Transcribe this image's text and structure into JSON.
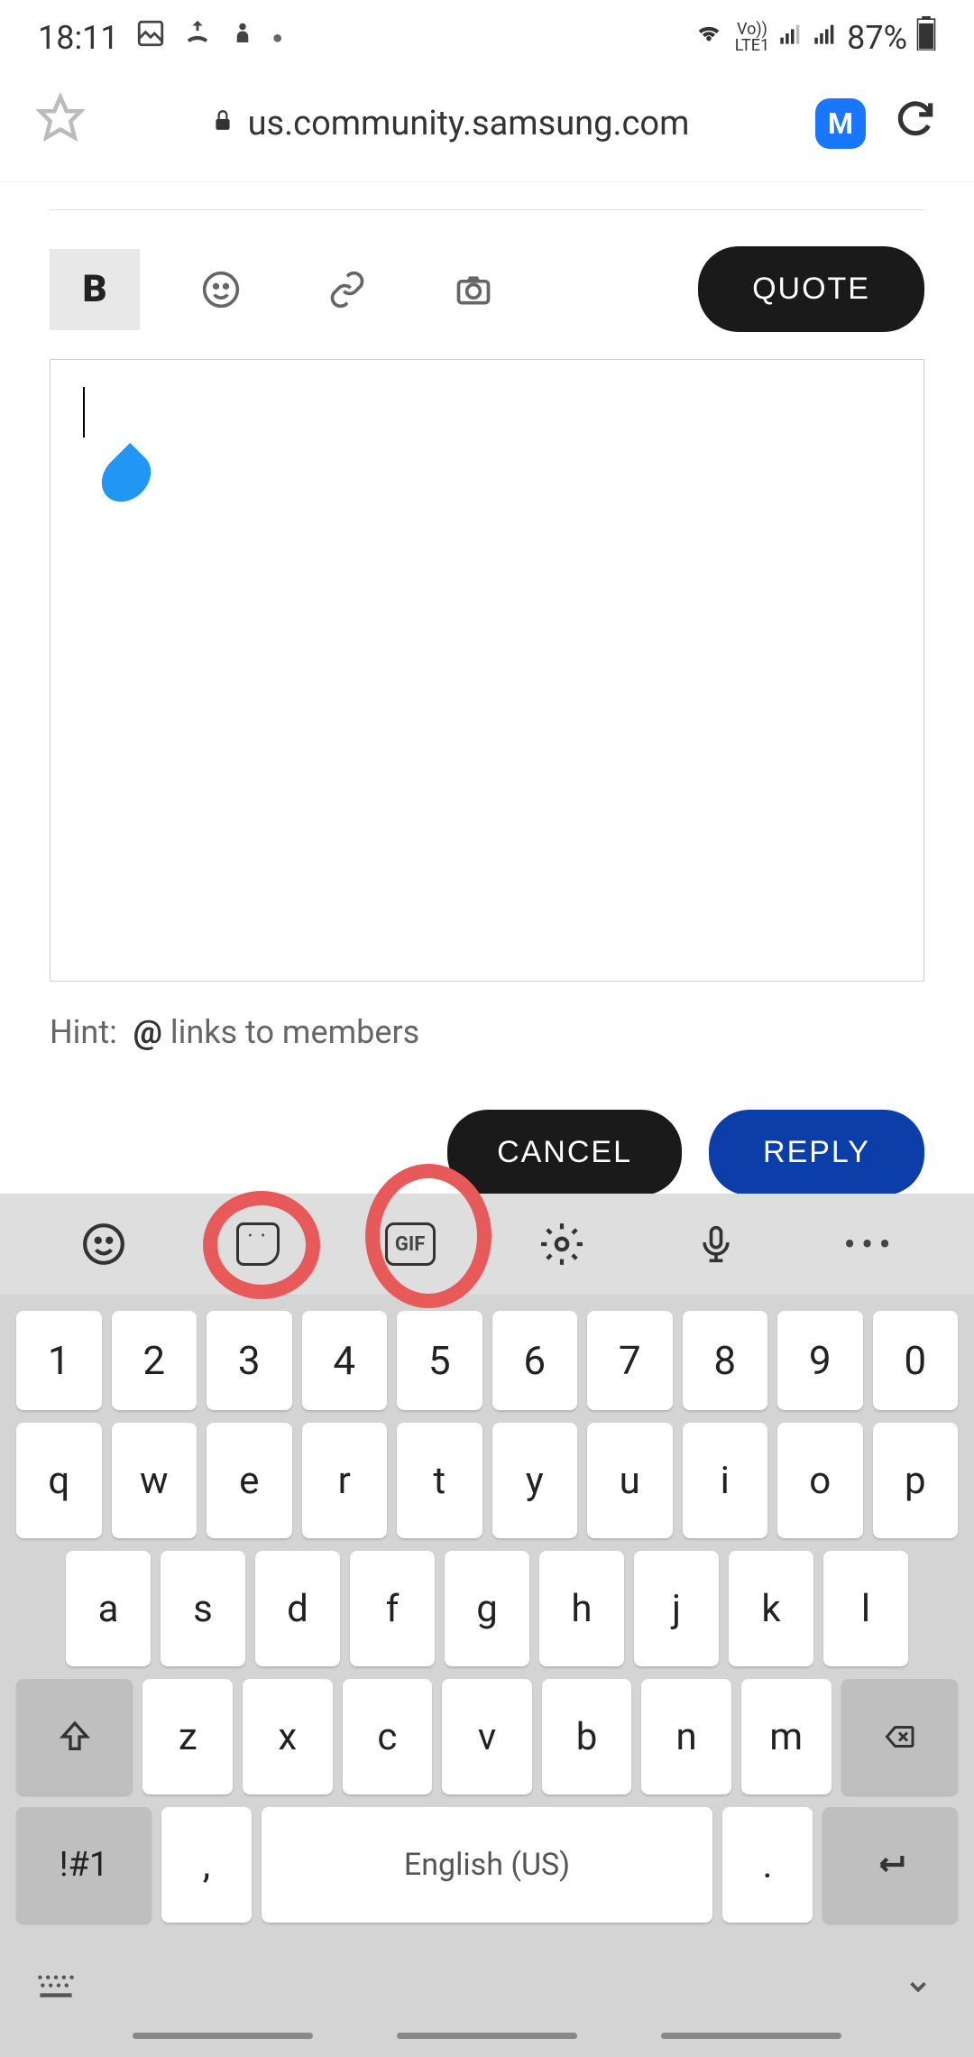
{
  "status": {
    "time": "18:11",
    "network_label": "Vo))",
    "lte_label": "LTE1",
    "battery": "87%"
  },
  "browser": {
    "url": "us.community.samsung.com",
    "badge": "M"
  },
  "editor": {
    "bold_label": "B",
    "quote_label": "QUOTE",
    "hint_prefix": "Hint:",
    "hint_at": "@",
    "hint_text": " links to members",
    "cancel_label": "CANCEL",
    "reply_label": "REPLY"
  },
  "keyboard": {
    "gif_label": "GIF",
    "row_numbers": [
      "1",
      "2",
      "3",
      "4",
      "5",
      "6",
      "7",
      "8",
      "9",
      "0"
    ],
    "row_top": [
      "q",
      "w",
      "e",
      "r",
      "t",
      "y",
      "u",
      "i",
      "o",
      "p"
    ],
    "row_mid": [
      "a",
      "s",
      "d",
      "f",
      "g",
      "h",
      "j",
      "k",
      "l"
    ],
    "row_bot": [
      "z",
      "x",
      "c",
      "v",
      "b",
      "n",
      "m"
    ],
    "sym_label": "!#1",
    "comma": ",",
    "space_label": "English (US)",
    "period": "."
  }
}
